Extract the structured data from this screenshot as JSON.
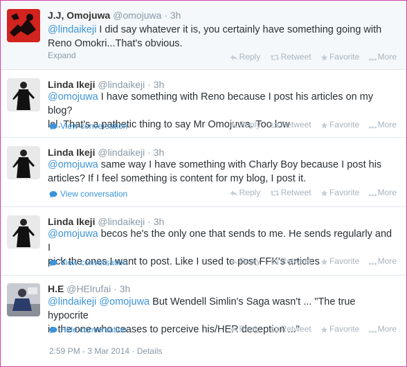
{
  "actions": {
    "reply": "Reply",
    "retweet": "Retweet",
    "favorite": "Favorite",
    "more": "More"
  },
  "tweets": [
    {
      "name": "J.J, Omojuwa",
      "handle": "@omojuwa",
      "time": "3h",
      "mention": "@lindaikeji",
      "line1": " I did say whatever it is, you certainly have something going with",
      "line2": "Reno Omokri...That's obvious.",
      "link": "Expand"
    },
    {
      "name": "Linda Ikeji",
      "handle": "@lindaikeji",
      "time": "3h",
      "mention": "@omojuwa",
      "line1": " I have something with Reno because I post his articles on my blog?",
      "line2": "lol. That's a pathetic thing to say Mr Omojuwa. Too low",
      "link": "View conversation"
    },
    {
      "name": "Linda Ikeji",
      "handle": "@lindaikeji",
      "time": "3h",
      "mention": "@omojuwa",
      "line1": " same way I have something with Charly Boy because I post his",
      "line2": "articles? If I feel something is content for my blog, I post it.",
      "link": "View conversation"
    },
    {
      "name": "Linda Ikeji",
      "handle": "@lindaikeji",
      "time": "3h",
      "mention": "@omojuwa",
      "line1": " becos he's the only one that sends to me. He sends regularly and I",
      "line2": "pick the ones I want to post. Like I used to post FFK's articles",
      "link": "View conversation"
    },
    {
      "name": "H.E",
      "handle": "@HElrufai",
      "time": "3h",
      "mention": "@lindaikeji",
      "mention2": "@omojuwa",
      "line1": " But Wendell Simlin's Saga wasn't ... \"The true hypocrite",
      "line2": "is the one who ceases to perceive his/HER deception ...\"",
      "link": "Hide conversation"
    }
  ],
  "footer": {
    "timestamp": "2:59 PM - 3 Mar 2014",
    "separator": "·",
    "details": "Details"
  },
  "colors": {
    "accent": "#3b94d9",
    "muted": "#8899a6",
    "action": "#a7b3bd",
    "border": "#d63ca8"
  }
}
